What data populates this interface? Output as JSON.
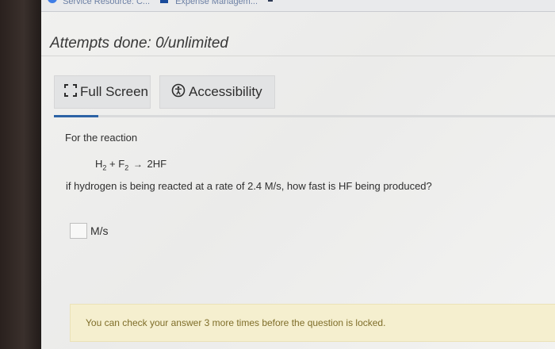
{
  "browser": {
    "tabs": [
      {
        "label": "Service Resource: C..."
      },
      {
        "label": "Expense Managem..."
      }
    ]
  },
  "assignment": {
    "attempts_label": "Attempts done: 0/unlimited"
  },
  "toolbar": {
    "full_screen_label": "Full Screen",
    "accessibility_label": "Accessibility"
  },
  "question": {
    "intro": "For the reaction",
    "reaction": {
      "r1": "H",
      "r1_sub": "2",
      "plus": "+",
      "r2": "F",
      "r2_sub": "2",
      "arrow": "→",
      "product": "2HF"
    },
    "prompt": "if hydrogen is being reacted at a rate of 2.4 M/s, how fast is HF being produced?",
    "answer": {
      "value": "",
      "unit": "M/s"
    }
  },
  "notice": {
    "text": "You can check your answer 3 more times before the question is locked."
  },
  "colors": {
    "progress": "#2d63a5",
    "notice_bg": "#f5efcf",
    "notice_text": "#7f6e2a"
  }
}
